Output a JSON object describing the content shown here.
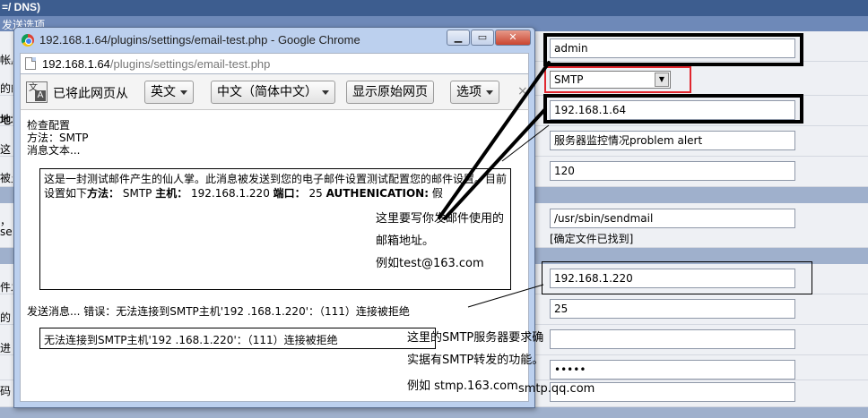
{
  "background": {
    "header_title": "=/ DNS)",
    "section_title": "发送选项",
    "left_labels": [
      "帐户",
      "的邮",
      "地址",
      "这",
      "被允",
      "，",
      "se",
      "件发",
      "的",
      "进",
      "码"
    ],
    "fields": {
      "account": "admin",
      "method": "SMTP",
      "host": "192.168.1.64",
      "subject": "服务器监控情况problem alert",
      "interval": "120",
      "sendmail_path": "/usr/sbin/sendmail",
      "sendmail_note": "[确定文件已找到]",
      "smtp_host": "192.168.1.220",
      "smtp_port": "25",
      "smtp_user": "",
      "smtp_password": "•••••",
      "last_field": ""
    }
  },
  "window": {
    "title": "192.168.1.64/plugins/settings/email-test.php - Google Chrome",
    "url_host": "192.168.1.64",
    "url_path": "/plugins/settings/email-test.php",
    "controls": {
      "minimize": "▁",
      "restore": "▭",
      "close": "✕"
    },
    "translate": {
      "text": "已将此网页从",
      "source_lang": "英文",
      "target_lang": "中文（简体中文）",
      "show_original": "显示原始网页",
      "options": "选项",
      "close": "×"
    },
    "content": {
      "line1": "检查配置",
      "line2": "方法：SMTP",
      "line3": "消息文本...",
      "msg_line1": "这是一封测试邮件产生的仙人掌。此消息被发送到您的电子邮件设置测试配置您的邮件设置。目前",
      "msg_line2_pre": "设置如下",
      "msg_line2_k1": "方法：",
      "msg_line2_v1": " SMTP ",
      "msg_line2_k2": "主机：",
      "msg_line2_v2": " 192.168.1.220 ",
      "msg_line2_k3": "端口：",
      "msg_line2_v3": " 25 ",
      "msg_line2_k4": "AUTHENICATION:",
      "msg_line2_v4": " 假",
      "sending": "发送消息... 错误：无法连接到SMTP主机'192 .168.1.220'：（111）连接被拒绝",
      "error_box": "无法连接到SMTP主机'192 .168.1.220'：（111）连接被拒绝"
    }
  },
  "annotations": {
    "a1_l1": "这里要写你发邮件使用的",
    "a1_l2": "邮箱地址。",
    "a1_l3": "例如test@163.com",
    "a2_l1": "这里的SMTP服务器要求确",
    "a2_l2": "实据有SMTP转发的功能。",
    "a2_l3": "例如 stmp.163.com",
    "a2_l4": "smtp.qq.com"
  }
}
